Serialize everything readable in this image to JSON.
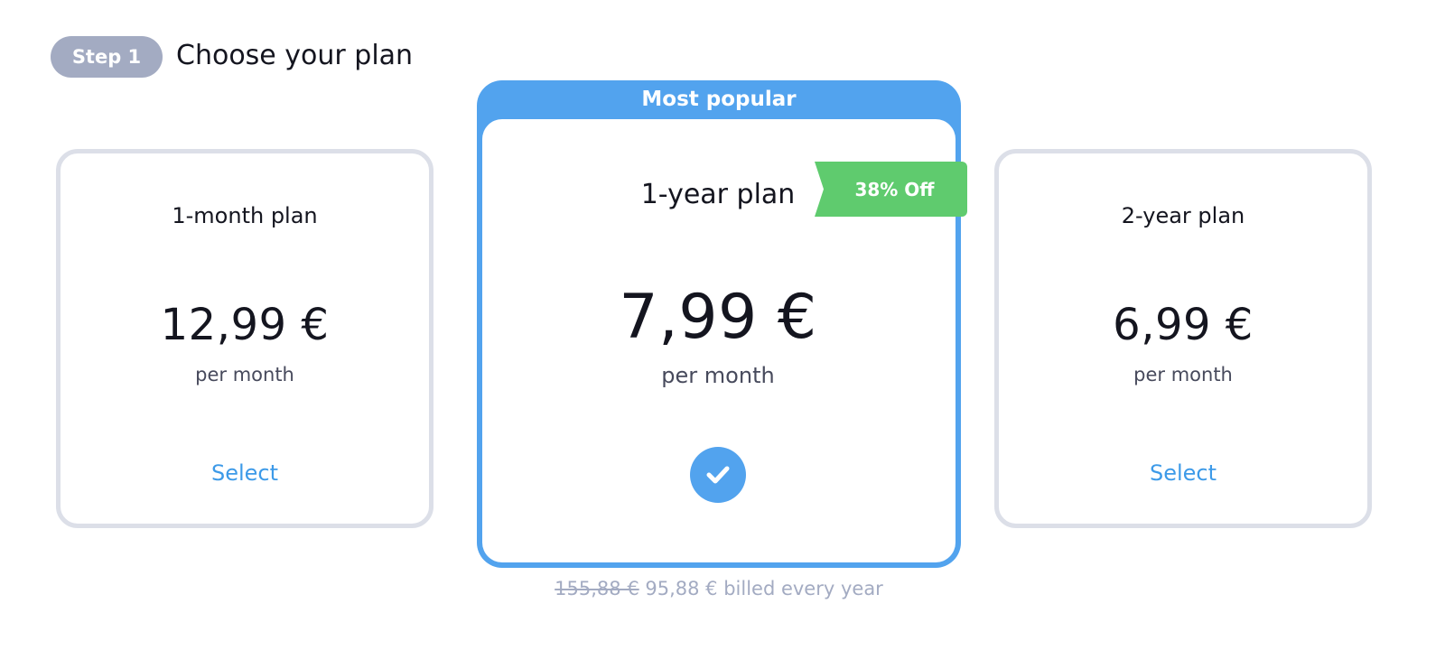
{
  "header": {
    "step_label": "Step 1",
    "title": "Choose your plan"
  },
  "plans": [
    {
      "name": "1-month plan",
      "price": "12,99 €",
      "period": "per month",
      "action": "Select"
    },
    {
      "badge": "Most popular",
      "name": "1-year plan",
      "discount": "38% Off",
      "price": "7,99 €",
      "period": "per month",
      "selected": true,
      "billing_old": "155,88 €",
      "billing_new": "95,88 € billed every year"
    },
    {
      "name": "2-year plan",
      "price": "6,99 €",
      "period": "per month",
      "action": "Select"
    }
  ],
  "colors": {
    "accent": "#52a3ee",
    "link": "#3d9ae8",
    "discount": "#5fcb6e",
    "muted": "#a3abc2",
    "card_border": "#dcdfe8"
  },
  "icons": {
    "selected": "check-icon"
  }
}
